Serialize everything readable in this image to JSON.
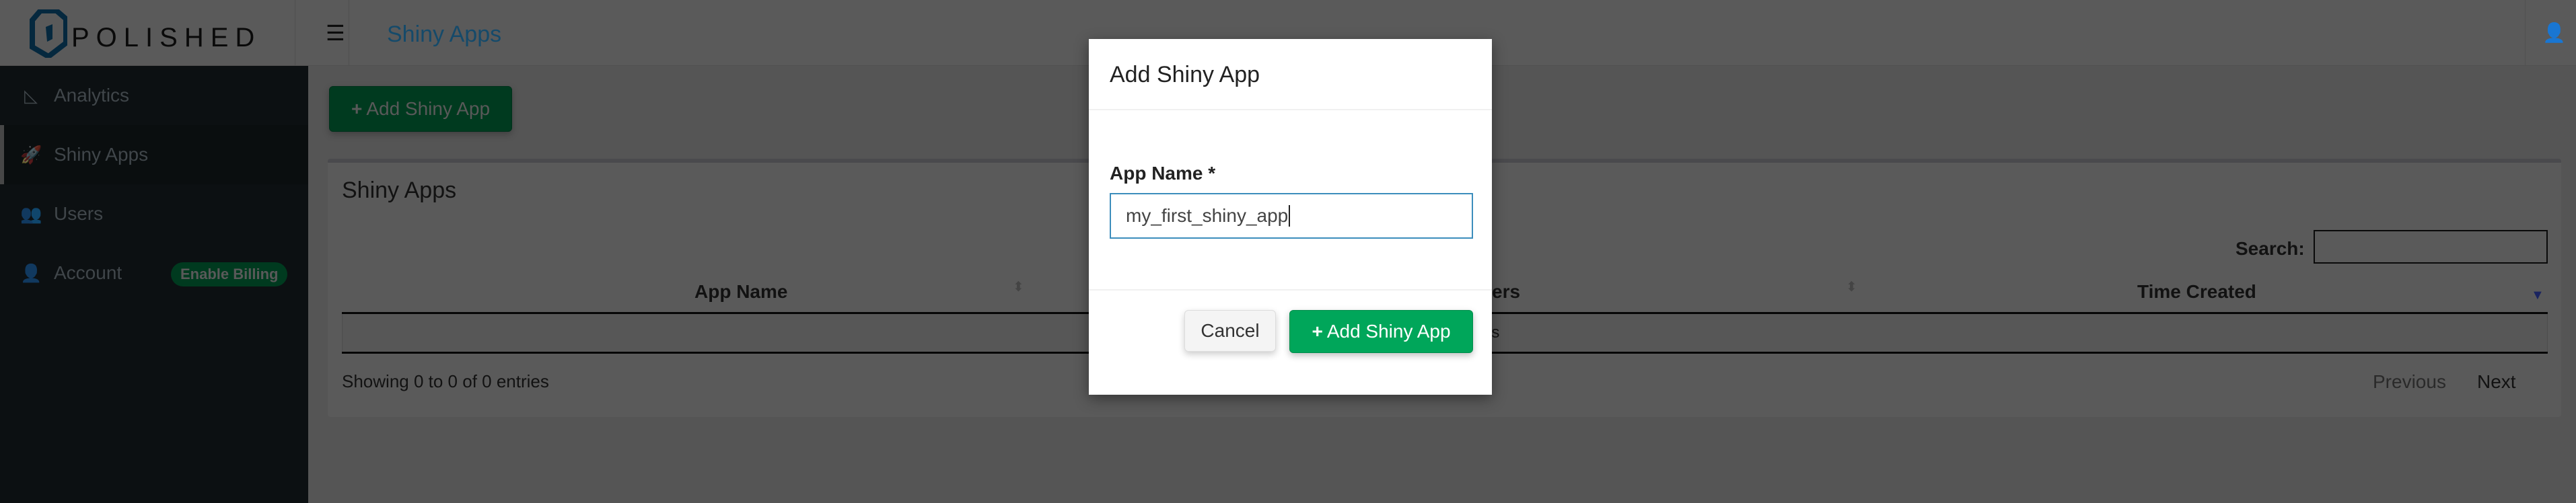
{
  "topbar": {
    "logo_text": "POLISHED",
    "page_title": "Shiny Apps",
    "menu_icon": "hamburger-icon",
    "user_icon": "user-icon"
  },
  "sidebar": {
    "items": [
      {
        "label": "Analytics",
        "icon": "chart-area-icon"
      },
      {
        "label": "Shiny Apps",
        "icon": "rocket-icon",
        "active": true
      },
      {
        "label": "Users",
        "icon": "users-icon"
      },
      {
        "label": "Account",
        "icon": "user-icon",
        "badge": "Enable Billing"
      }
    ]
  },
  "main": {
    "add_button": "Add Shiny App",
    "box_title": "Shiny Apps",
    "search_label": "Search:",
    "search_value": "",
    "columns": [
      "App Name",
      "ers",
      "Time Created"
    ],
    "empty_row_fragment": "ps",
    "info": "Showing 0 to 0 of 0 entries",
    "prev": "Previous",
    "next": "Next"
  },
  "modal": {
    "title": "Add Shiny App",
    "field_label": "App Name *",
    "field_value": "my_first_shiny_app",
    "cancel": "Cancel",
    "submit": "Add Shiny App"
  },
  "colors": {
    "brand_green": "#00a65a",
    "link_blue": "#3c8dbc",
    "sidebar": "#222d32",
    "logo_blue": "#0f4c73"
  }
}
